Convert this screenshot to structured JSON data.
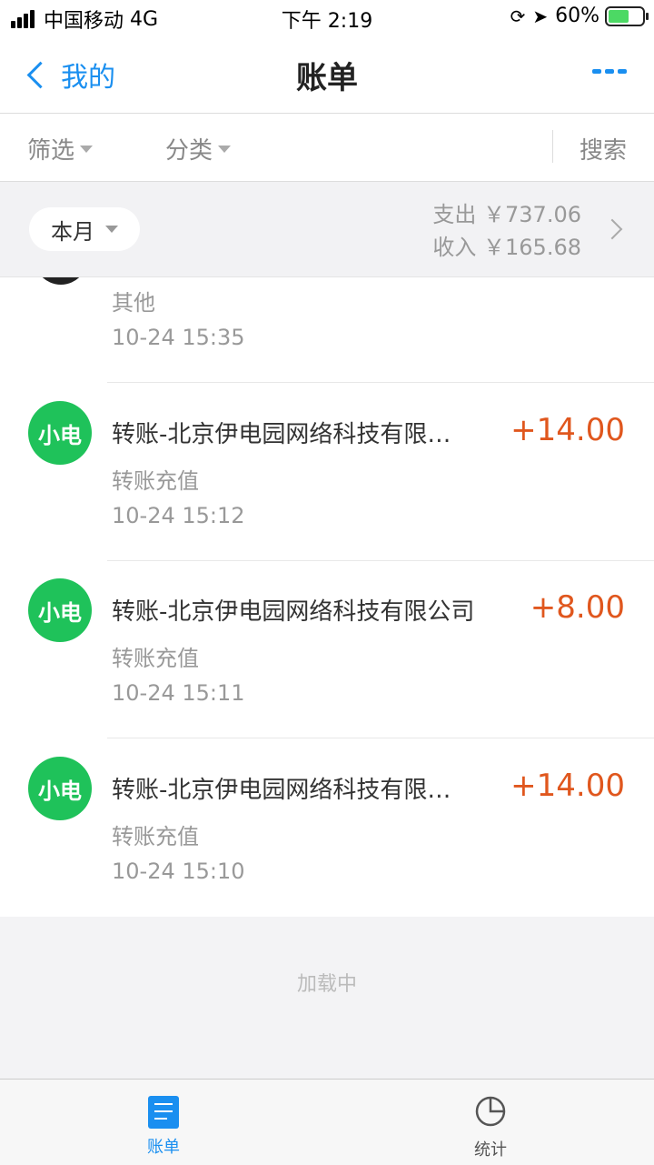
{
  "status_bar": {
    "carrier": "中国移动",
    "network": "4G",
    "time": "下午 2:19",
    "battery": "60%"
  },
  "nav": {
    "back_label": "我的",
    "title": "账单"
  },
  "filters": {
    "filter": "筛选",
    "category": "分类",
    "search": "搜索"
  },
  "summary": {
    "month": "本月",
    "expense": "支出 ￥737.06",
    "income": "收入 ￥165.68"
  },
  "partial_row": {
    "subtitle": "其他",
    "time": "10-24  15:35"
  },
  "rows": [
    {
      "avatar": "小电",
      "title": "转账-北京伊电园网络科技有限…",
      "amount": "+14.00",
      "subtitle": "转账充值",
      "time": "10-24  15:12"
    },
    {
      "avatar": "小电",
      "title": "转账-北京伊电园网络科技有限公司",
      "amount": "+8.00",
      "subtitle": "转账充值",
      "time": "10-24  15:11"
    },
    {
      "avatar": "小电",
      "title": "转账-北京伊电园网络科技有限…",
      "amount": "+14.00",
      "subtitle": "转账充值",
      "time": "10-24  15:10"
    }
  ],
  "loading_text": "加载中",
  "tabs": [
    {
      "label": "账单"
    },
    {
      "label": "统计"
    }
  ],
  "colors": {
    "accent": "#1a8ff0",
    "amount": "#e0571e",
    "avatar": "#1fc25a"
  }
}
